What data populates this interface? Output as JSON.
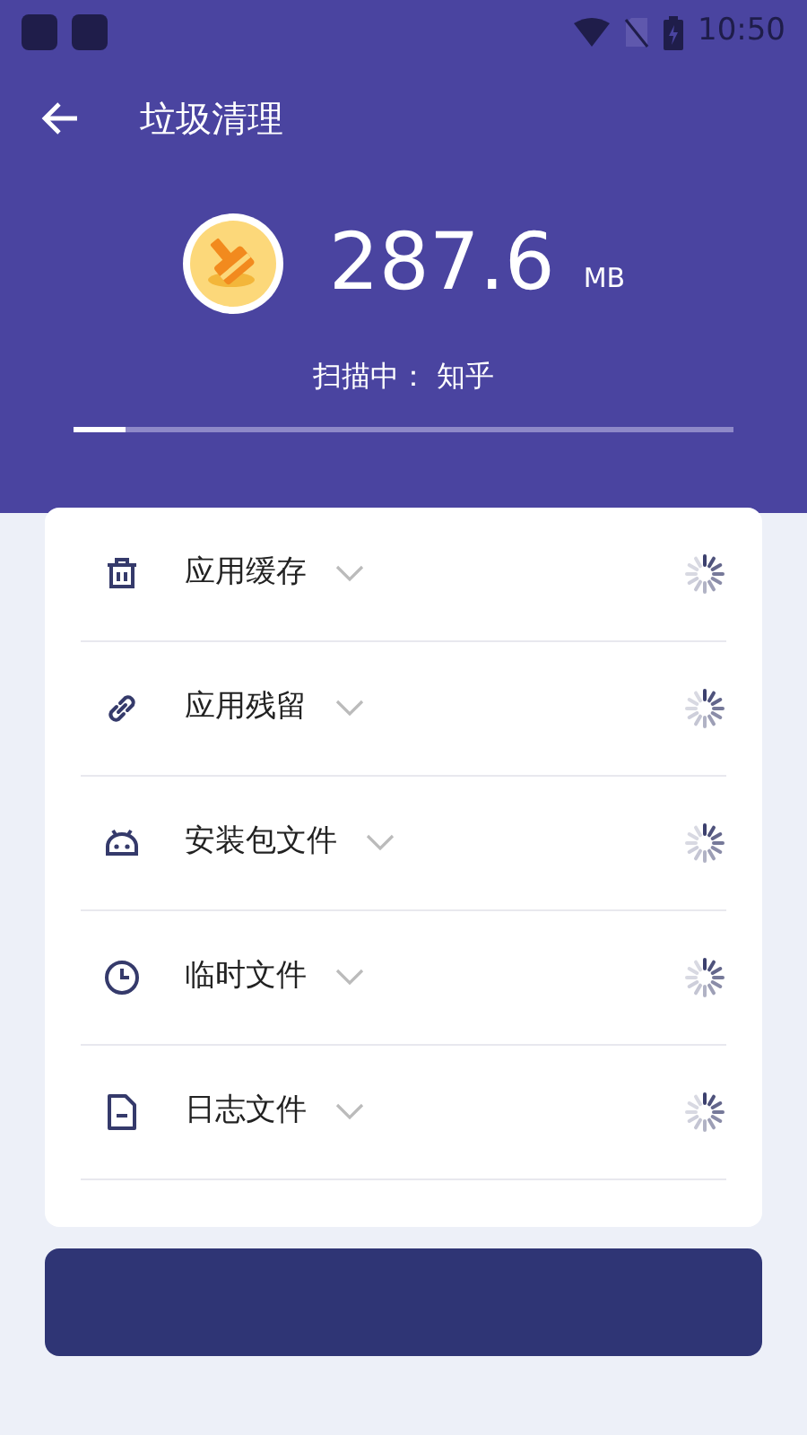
{
  "status_bar": {
    "time": "10:50"
  },
  "app_bar": {
    "title": "垃圾清理"
  },
  "scan": {
    "size": "287.6",
    "unit": "MB",
    "status": "扫描中：  知乎",
    "level": 0.08
  },
  "categories": [
    {
      "kind": "trash",
      "label": "应用缓存"
    },
    {
      "kind": "link",
      "label": "应用残留"
    },
    {
      "kind": "android",
      "label": "安装包文件"
    },
    {
      "kind": "clock",
      "label": "临时文件"
    },
    {
      "kind": "file",
      "label": "日志文件"
    }
  ]
}
